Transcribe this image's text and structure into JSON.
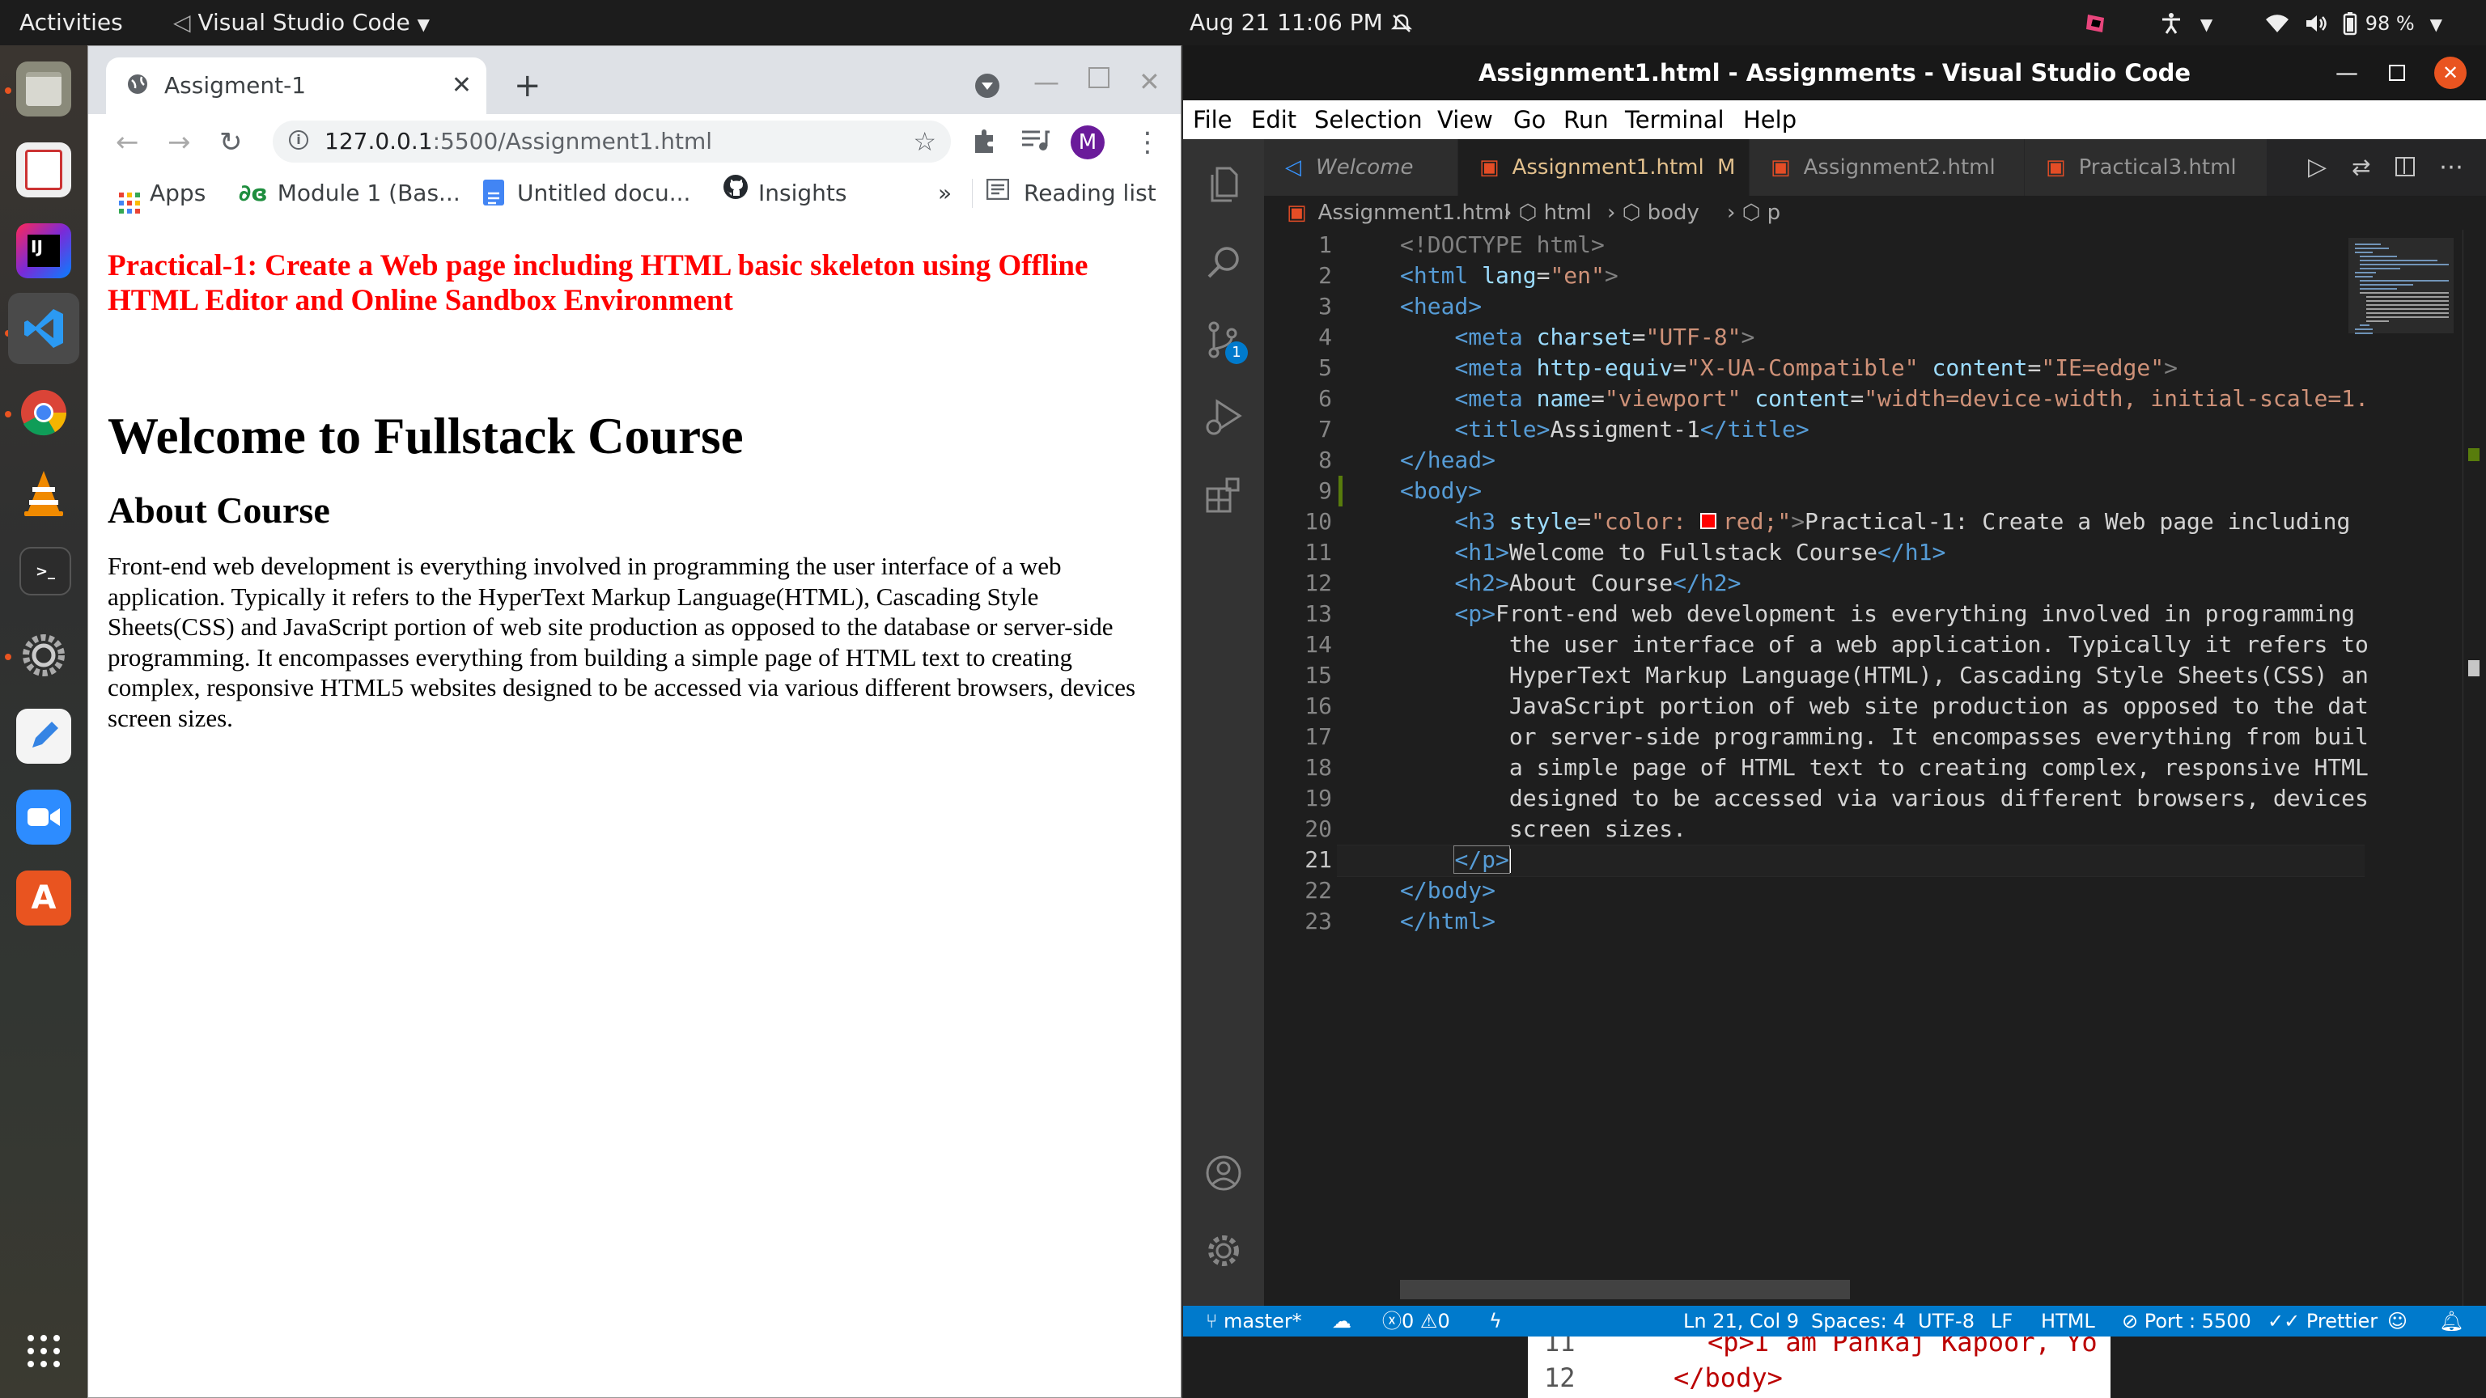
{
  "topbar": {
    "activities": "Activities",
    "app_name": "Visual Studio Code",
    "clock": "Aug 21  11:06 PM",
    "battery": "98 %"
  },
  "dock": {
    "items": [
      "files-icon",
      "office-icon",
      "intellij-icon",
      "vscode-icon",
      "chrome-icon",
      "vlc-icon",
      "terminal-icon",
      "settings-icon",
      "text-editor-icon",
      "zoom-icon",
      "software-center-icon",
      "app-grid-icon"
    ]
  },
  "browser": {
    "tab_title": "Assigment-1",
    "url_host": "127.0.0.1",
    "url_rest": ":5500/Assignment1.html",
    "profile_initial": "M",
    "bookmarks": {
      "apps": "Apps",
      "module": "Module 1 (Bas...",
      "untitled": "Untitled docu...",
      "insights": "Insights",
      "more": "»",
      "reading_list": "Reading list"
    },
    "page": {
      "h3": "Practical-1: Create a Web page including HTML basic skeleton using Offline HTML Editor and Online Sandbox Environment",
      "h1": "Welcome to Fullstack Course",
      "h2": "About Course",
      "p": "Front-end web development is everything involved in programming the user interface of a web application. Typically it refers to the HyperText Markup Language(HTML), Cascading Style Sheets(CSS) and JavaScript portion of web site production as opposed to the database or server-side programming. It encompasses everything from building a simple page of HTML text to creating complex, responsive HTML5 websites designed to be accessed via various different browsers, devices screen sizes."
    }
  },
  "vscode": {
    "title": "Assignment1.html - Assignments - Visual Studio Code",
    "menu": [
      "File",
      "Edit",
      "Selection",
      "View",
      "Go",
      "Run",
      "Terminal",
      "Help"
    ],
    "tabs": [
      {
        "label": "Welcome"
      },
      {
        "label": "Assignment1.html",
        "modified": "M"
      },
      {
        "label": "Assignment2.html"
      },
      {
        "label": "Practical3.html"
      }
    ],
    "breadcrumb": [
      "Assignment1.html",
      "html",
      "body",
      "p"
    ],
    "scm_badge": "1",
    "line_numbers": [
      "1",
      "2",
      "3",
      "4",
      "5",
      "6",
      "7",
      "8",
      "9",
      "10",
      "11",
      "12",
      "13",
      "14",
      "15",
      "16",
      "17",
      "18",
      "19",
      "20",
      "21",
      "22",
      "23"
    ],
    "code": {
      "l1": "<!DOCTYPE html>",
      "l2_tag": "<html ",
      "l2_attr": "lang",
      "l2_val": "\"en\"",
      "l2_end": ">",
      "l3": "<head>",
      "l4_tag": "<meta ",
      "l4_attr": "charset",
      "l4_val": "\"UTF-8\"",
      "l4_end": ">",
      "l5_tag": "<meta ",
      "l5_attr": "http-equiv",
      "l5_val": "\"X-UA-Compatible\"",
      "l5_attr2": "content",
      "l5_val2": "\"IE=edge\"",
      "l5_end": ">",
      "l6_tag": "<meta ",
      "l6_attr": "name",
      "l6_val": "\"viewport\"",
      "l6_attr2": "content",
      "l6_val2": "\"width=device-width, initial-scale=1.",
      "l7_open": "<title>",
      "l7_text": "Assigment-1",
      "l7_close": "</title>",
      "l8": "</head>",
      "l9": "<body>",
      "l10_tag": "<h3 ",
      "l10_attr": "style",
      "l10_val1": "\"color: ",
      "l10_val2": "red;\"",
      "l10_end": ">",
      "l10_text": "Practical-1: Create a Web page including",
      "l11_open": "<h1>",
      "l11_text": "Welcome to Fullstack Course",
      "l11_close": "</h1>",
      "l12_open": "<h2>",
      "l12_text": "About Course",
      "l12_close": "</h2>",
      "l13_open": "<p>",
      "l13_text": "Front-end web development is everything involved in programming",
      "l14": "the user interface of a web application. Typically it refers to",
      "l15": "HyperText Markup Language(HTML), Cascading Style Sheets(CSS) an",
      "l16": "JavaScript portion of web site production as opposed to the dat",
      "l17": "or server-side programming. It encompasses everything from buil",
      "l18": "a simple page of HTML text to creating complex, responsive HTML",
      "l19": "designed to be accessed via various different browsers, devices",
      "l20": "screen sizes.",
      "l21": "</p>",
      "l22": "</body>",
      "l23": "</html>"
    },
    "status": {
      "branch": "master*",
      "errors": "0",
      "warnings": "0",
      "cursor": "Ln 21, Col 9",
      "spaces": "Spaces: 4",
      "encoding": "UTF-8",
      "eol": "LF",
      "language": "HTML",
      "port": "Port : 5500",
      "prettier": "Prettier"
    }
  },
  "behind_window": {
    "line11_num": "11",
    "line11_code": "<p>I am Pankaj Kapoor, Yo",
    "line12_num": "12",
    "line12_code": "</body>"
  },
  "colors": {
    "vscode_blue": "#007acc",
    "ubuntu_orange": "#e95420",
    "h3_red": "#ff0000"
  }
}
